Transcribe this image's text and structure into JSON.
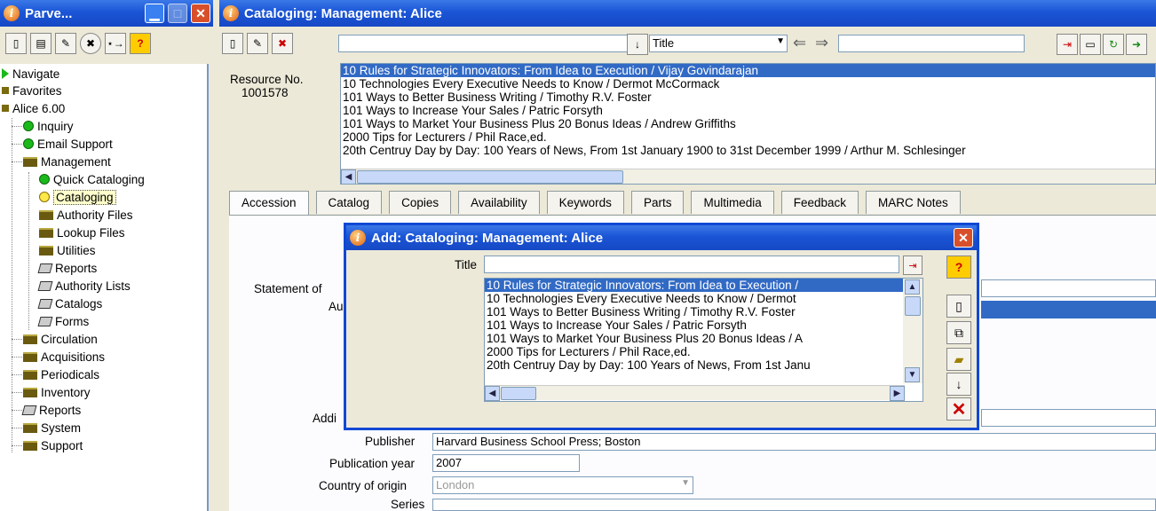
{
  "nav_window": {
    "title": "Parve..."
  },
  "main_window": {
    "title": "Cataloging: Management: Alice"
  },
  "nav_toolbar_icons": [
    "new-doc-icon",
    "form-icon",
    "edit-icon",
    "cancel-circle-icon",
    "star-arrow-icon",
    "help-icon"
  ],
  "main_toolbar": {
    "search_text": "",
    "field_select": "Title",
    "nav_input": ""
  },
  "tree": {
    "items": [
      {
        "label": "Navigate",
        "icon": "arrow-green-icon"
      },
      {
        "label": "Favorites",
        "icon": "square-icon"
      },
      {
        "label": "Alice 6.00",
        "icon": "square-icon"
      },
      {
        "label": "Inquiry",
        "icon": "green-dot-icon"
      },
      {
        "label": "Email Support",
        "icon": "green-dot-icon"
      },
      {
        "label": "Management",
        "icon": "folder-icon"
      },
      {
        "label": "Quick Cataloging",
        "icon": "green-dot-icon"
      },
      {
        "label": "Cataloging",
        "icon": "yellow-dot-icon"
      },
      {
        "label": "Authority Files",
        "icon": "folder-icon"
      },
      {
        "label": "Lookup Files",
        "icon": "folder-icon"
      },
      {
        "label": "Utilities",
        "icon": "folder-icon"
      },
      {
        "label": "Reports",
        "icon": "printer-icon"
      },
      {
        "label": "Authority Lists",
        "icon": "printer-icon"
      },
      {
        "label": "Catalogs",
        "icon": "printer-icon"
      },
      {
        "label": "Forms",
        "icon": "printer-icon"
      },
      {
        "label": "Circulation",
        "icon": "folder-icon"
      },
      {
        "label": "Acquisitions",
        "icon": "folder-icon"
      },
      {
        "label": "Periodicals",
        "icon": "folder-icon"
      },
      {
        "label": "Inventory",
        "icon": "folder-icon"
      },
      {
        "label": "Reports",
        "icon": "printer-icon"
      },
      {
        "label": "System",
        "icon": "folder-icon"
      },
      {
        "label": "Support",
        "icon": "folder-icon"
      }
    ]
  },
  "resource": {
    "label": "Resource No.",
    "number": "1001578"
  },
  "title_list": [
    "10 Rules for Strategic Innovators: From Idea to Execution / Vijay Govindarajan",
    "10 Technologies Every Executive Needs to Know / Dermot McCormack",
    "101 Ways to Better Business Writing / Timothy R.V. Foster",
    "101 Ways to Increase Your Sales / Patric Forsyth",
    "101 Ways to Market Your Business Plus 20 Bonus Ideas / Andrew Griffiths",
    "2000 Tips for Lecturers / Phil Race,ed.",
    "20th Centruy Day by Day: 100 Years of News, From 1st January 1900 to 31st December 1999 / Arthur M. Schlesinger"
  ],
  "tabs": [
    "Accession",
    "Catalog",
    "Copies",
    "Availability",
    "Keywords",
    "Parts",
    "Multimedia",
    "Feedback",
    "MARC Notes"
  ],
  "form": {
    "statement_label": "Statement of",
    "au_label": "Au",
    "addi_label": "Addi",
    "publisher_label": "Publisher",
    "publisher_value": "Harvard Business School Press; Boston",
    "pubyear_label": "Publication year",
    "pubyear_value": "2007",
    "country_label": "Country of origin",
    "country_value": "London",
    "series_label": "Series"
  },
  "dialog": {
    "title": "Add: Cataloging: Management: Alice",
    "title_label": "Title",
    "title_value": "",
    "list": [
      "10 Rules for Strategic Innovators: From Idea to Execution /",
      "10 Technologies Every Executive Needs to Know / Dermot",
      "101 Ways to Better Business Writing / Timothy R.V. Foster",
      "101 Ways to Increase Your Sales / Patric Forsyth",
      "101 Ways to Market Your Business Plus 20 Bonus Ideas / A",
      "2000 Tips for Lecturers / Phil Race,ed.",
      "20th Centruy Day by Day: 100 Years of News, From 1st Janu"
    ]
  }
}
